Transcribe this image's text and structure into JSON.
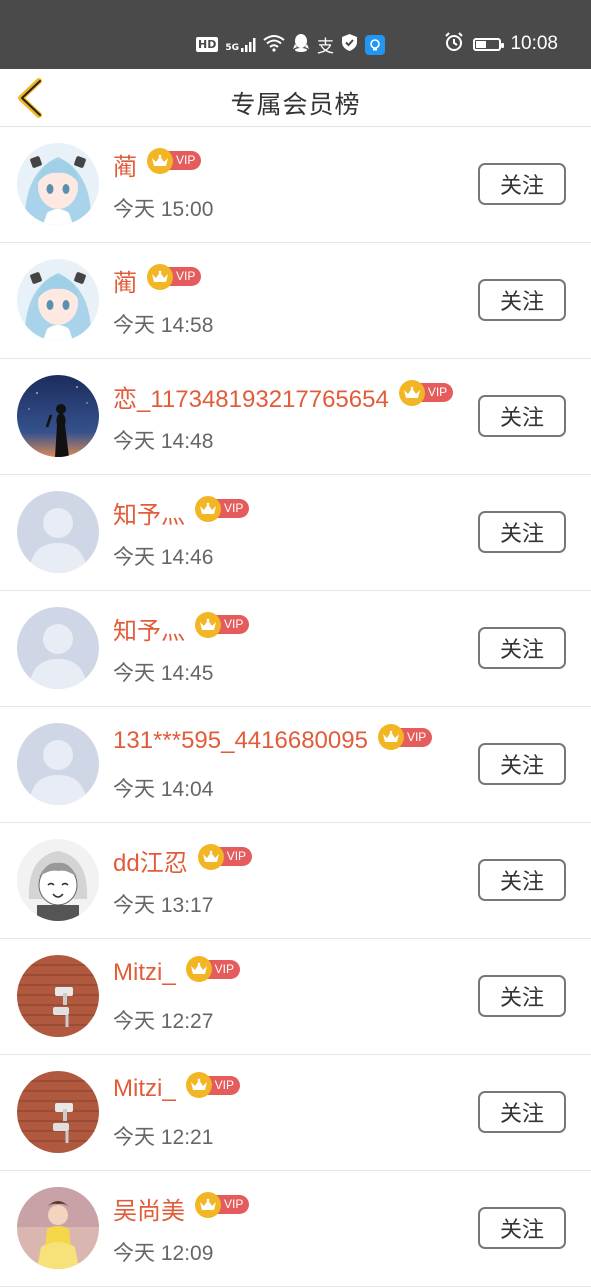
{
  "status_bar": {
    "hd": "HD",
    "network": "5G",
    "alipay_glyph": "支",
    "time": "10:08",
    "battery_level": 0.45,
    "icons": [
      "hd-icon",
      "signal-icon",
      "wifi-icon",
      "qq-icon",
      "alipay-icon",
      "shield-icon",
      "bulb-icon",
      "alarm-icon",
      "battery-icon"
    ]
  },
  "header": {
    "title": "专属会员榜",
    "back_icon": "chevron-left-icon",
    "accent": "#f2b523"
  },
  "vip_label": "VIP",
  "follow_label": "关注",
  "colors": {
    "name": "#e25c3a",
    "vip_badge": "#e45c5c",
    "crown": "#f2b523",
    "statusbar": "#4a4a4a"
  },
  "members": [
    {
      "name": "蔺",
      "time": "今天 15:00",
      "avatar": "anime-girl"
    },
    {
      "name": "蔺",
      "time": "今天 14:58",
      "avatar": "anime-girl"
    },
    {
      "name": "恋_117348193217765654",
      "time": "今天 14:48",
      "avatar": "night-sky"
    },
    {
      "name": "知予灬",
      "time": "今天 14:46",
      "avatar": "default"
    },
    {
      "name": "知予灬",
      "time": "今天 14:45",
      "avatar": "default"
    },
    {
      "name": "131***595_4416680095",
      "time": "今天 14:04",
      "avatar": "default"
    },
    {
      "name": "dd江忍",
      "time": "今天 13:17",
      "avatar": "manga"
    },
    {
      "name": "Mitzi_",
      "time": "今天 12:27",
      "avatar": "brick-wall"
    },
    {
      "name": "Mitzi_",
      "time": "今天 12:21",
      "avatar": "brick-wall"
    },
    {
      "name": "吴尚美",
      "time": "今天 12:09",
      "avatar": "photo"
    }
  ]
}
